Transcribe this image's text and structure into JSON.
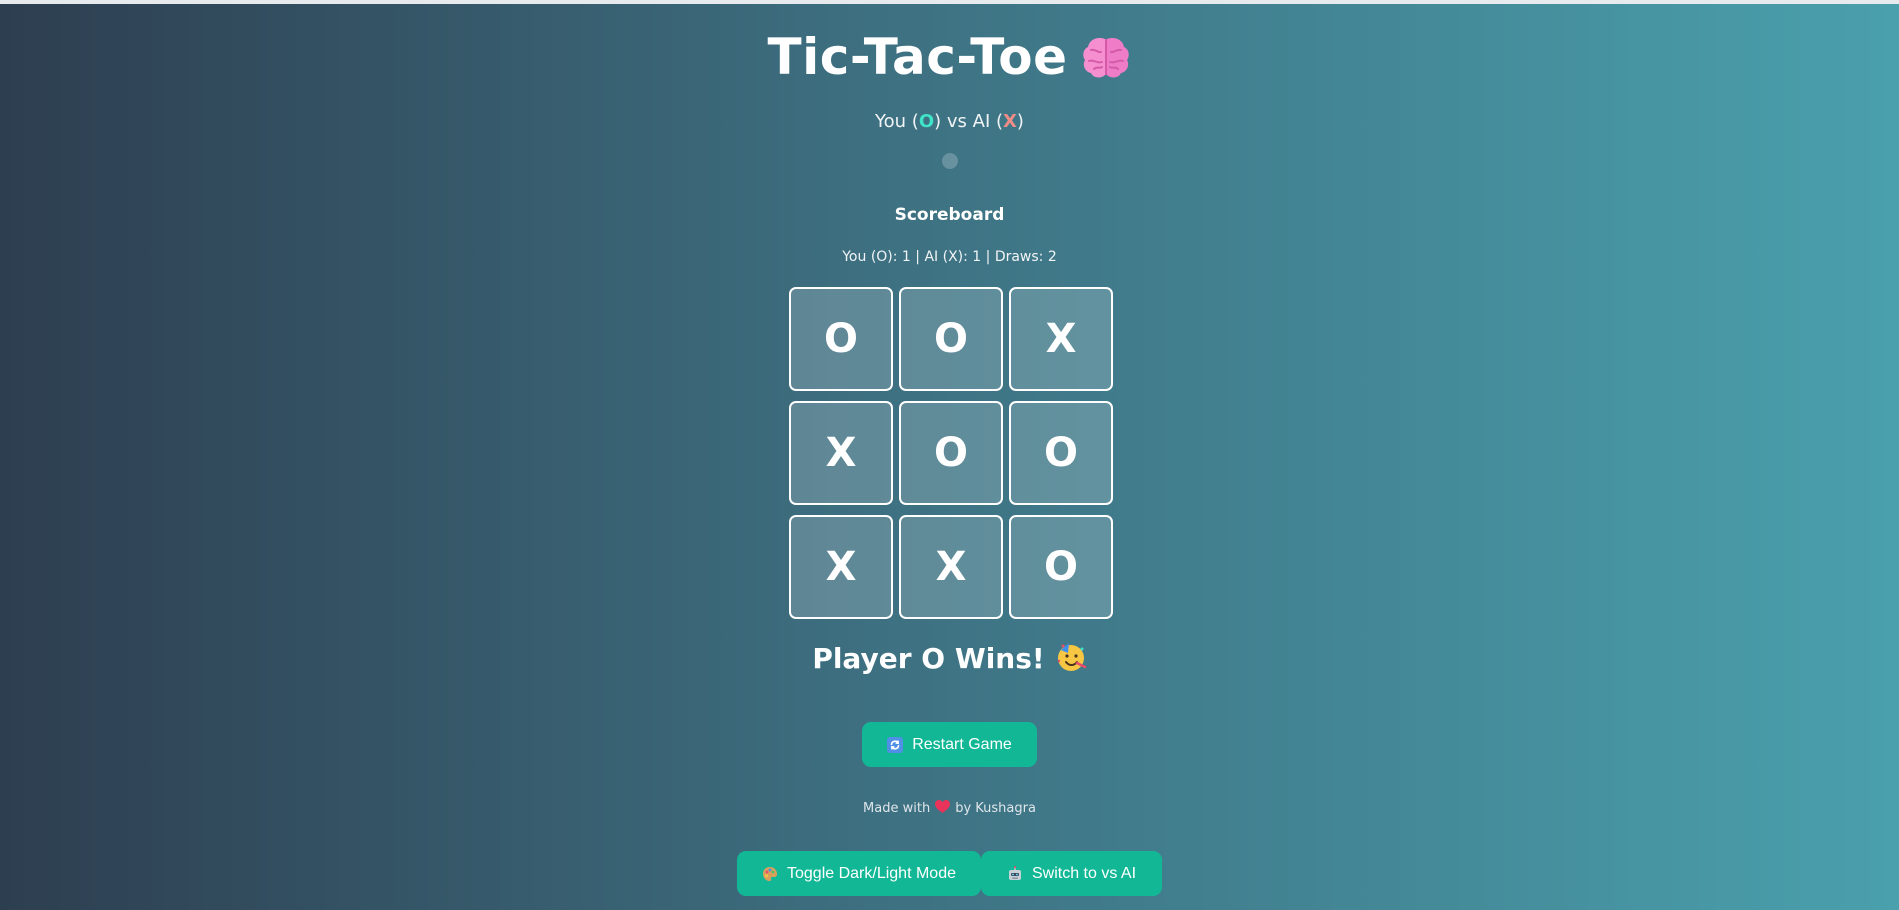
{
  "game": {
    "title": "Tic-Tac-Toe",
    "title_icon": "brain-icon",
    "subtitle_prefix": "You (",
    "player_symbol": "O",
    "subtitle_middle": ") vs AI (",
    "ai_symbol": "X",
    "subtitle_suffix": ")"
  },
  "scoreboard": {
    "heading": "Scoreboard",
    "summary": "You (O): 1 | AI (X): 1 | Draws: 2"
  },
  "board": {
    "cells": [
      "O",
      "O",
      "X",
      "X",
      "O",
      "O",
      "X",
      "X",
      "O"
    ]
  },
  "result": {
    "text": "Player O Wins!",
    "icon": "party-face-icon"
  },
  "buttons": {
    "restart_label": "Restart Game",
    "restart_icon": "refresh-icon",
    "toggle_theme_label": "Toggle Dark/Light Mode",
    "toggle_theme_icon": "palette-icon",
    "switch_mode_label": "Switch to vs AI",
    "switch_mode_icon": "robot-icon"
  },
  "footer": {
    "prefix": "Made with",
    "suffix": "by Kushagra",
    "icon": "heart-icon"
  },
  "colors": {
    "accent_button": "#12b896",
    "player_o": "#3fe3c8",
    "ai_x": "#f08d86",
    "bg_left": "#2d3e50",
    "bg_right": "#4aa0ad"
  }
}
